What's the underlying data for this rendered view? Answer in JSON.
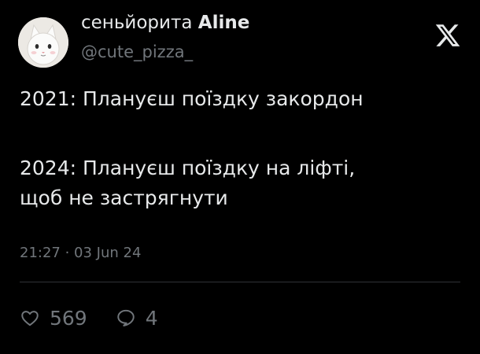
{
  "author": {
    "display_name_prefix": "сеньйорита ",
    "display_name_bold": "Aline",
    "handle": "@cute_pizza_",
    "avatar_icon": "white-cat-avatar"
  },
  "brand_icon": "x-logo-icon",
  "tweet": {
    "line1": "2021: Плануєш поїздку закордон",
    "line2": "2024: Плануєш поїздку на ліфті,",
    "line3": "щоб не застрягнути",
    "timestamp": "21:27 · 03 Jun 24"
  },
  "actions": {
    "likes_count": "569",
    "replies_count": "4"
  },
  "colors": {
    "background": "#000000",
    "primary_text": "#e7e9ea",
    "secondary_text": "#71767b",
    "divider": "#2f3336"
  }
}
